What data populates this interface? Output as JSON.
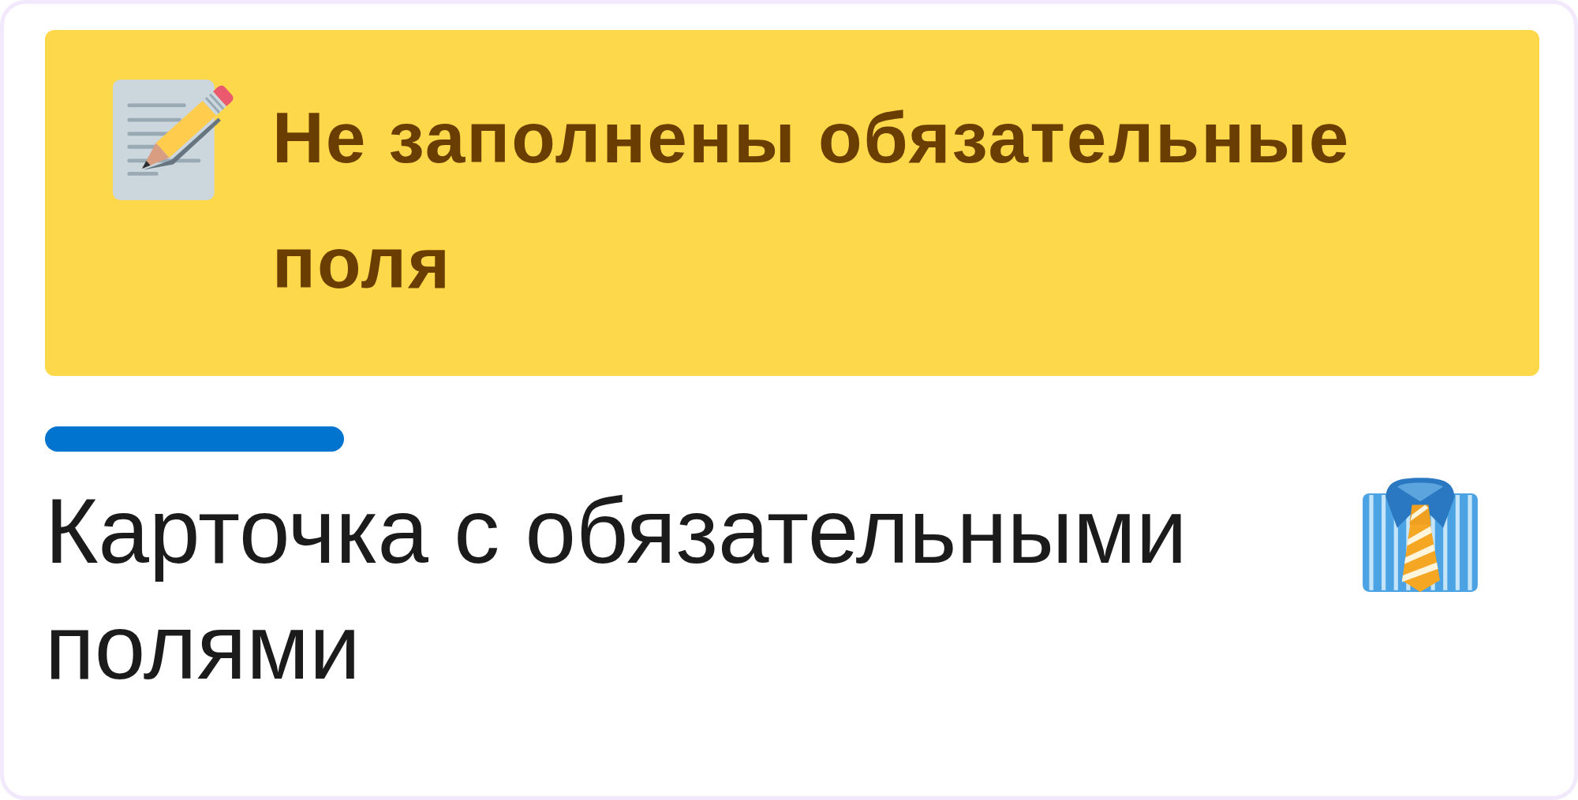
{
  "alert": {
    "message": "Не заполнены обязательные поля"
  },
  "card": {
    "title": "Карточка с обязательными полями"
  }
}
